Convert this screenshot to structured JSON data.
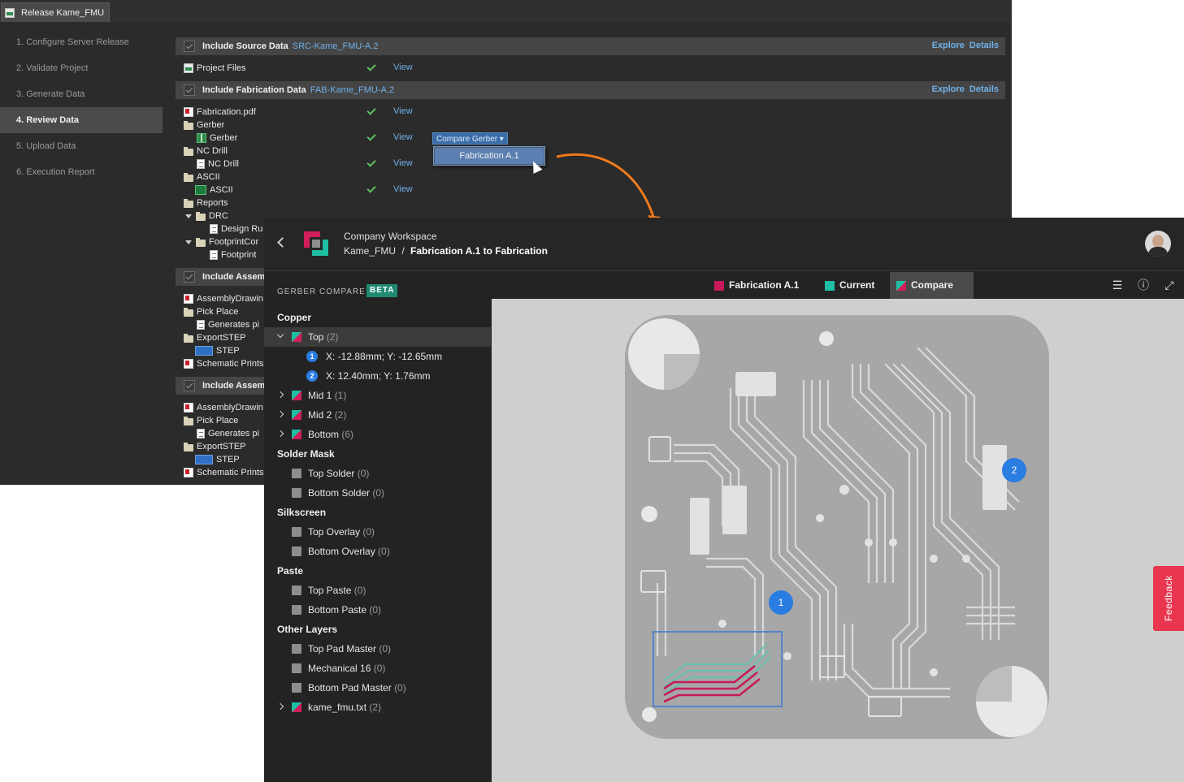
{
  "release_window": {
    "tab_label": "Release Kame_FMU",
    "steps": [
      {
        "label": "1. Configure Server Release"
      },
      {
        "label": "2. Validate Project"
      },
      {
        "label": "3. Generate Data"
      },
      {
        "label": "4. Review Data"
      },
      {
        "label": "5. Upload Data"
      },
      {
        "label": "6. Execution Report"
      }
    ],
    "active_step": "4. Review Data",
    "sections": [
      {
        "title": "Include Source Data",
        "id": "SRC-Kame_FMU-A.2",
        "explore": "Explore",
        "details": "Details"
      },
      {
        "title": "Include Fabrication Data",
        "id": "FAB-Kame_FMU-A.2",
        "explore": "Explore",
        "details": "Details"
      },
      {
        "title": "Include Assem"
      },
      {
        "title": "Include Assem"
      }
    ],
    "rows": [
      {
        "label": "Project Files",
        "view": "View"
      },
      {
        "label": "Fabrication.pdf",
        "view": "View"
      },
      {
        "label": "Gerber"
      },
      {
        "label": "Gerber",
        "view": "View"
      },
      {
        "label": "NC Drill"
      },
      {
        "label": "NC Drill",
        "view": "View"
      },
      {
        "label": "ASCII"
      },
      {
        "label": "ASCII",
        "view": "View"
      },
      {
        "label": "Reports"
      },
      {
        "label": "DRC"
      },
      {
        "label": "Design Ru"
      },
      {
        "label": "FootprintCor"
      },
      {
        "label": "Footprint"
      },
      {
        "label": "AssemblyDrawin"
      },
      {
        "label": "Pick Place"
      },
      {
        "label": "Generates pi"
      },
      {
        "label": "ExportSTEP"
      },
      {
        "label": "STEP"
      },
      {
        "label": "Schematic Prints"
      },
      {
        "label": "AssemblyDrawin"
      },
      {
        "label": "Pick Place"
      },
      {
        "label": "Generates pi"
      },
      {
        "label": "ExportSTEP"
      },
      {
        "label": "STEP"
      },
      {
        "label": "Schematic Prints"
      }
    ],
    "compare_button": "Compare Gerber ▾",
    "compare_menu_item": "Fabrication A.1"
  },
  "web": {
    "workspace": "Company Workspace",
    "project": "Kame_FMU",
    "separator": "/",
    "page_title": "Fabrication A.1 to Fabrication",
    "panel_title": "GERBER COMPARE",
    "beta": "BETA",
    "groups": {
      "copper": "Copper",
      "solder_mask": "Solder Mask",
      "silkscreen": "Silkscreen",
      "paste": "Paste",
      "other": "Other Layers"
    },
    "layers": {
      "top": {
        "name": "Top",
        "count": "(2)"
      },
      "mid1": {
        "name": "Mid 1",
        "count": "(1)"
      },
      "mid2": {
        "name": "Mid 2",
        "count": "(2)"
      },
      "bottom": {
        "name": "Bottom",
        "count": "(6)"
      },
      "top_solder": {
        "name": "Top Solder",
        "count": "(0)"
      },
      "bottom_solder": {
        "name": "Bottom Solder",
        "count": "(0)"
      },
      "top_overlay": {
        "name": "Top Overlay",
        "count": "(0)"
      },
      "bottom_overlay": {
        "name": "Bottom Overlay",
        "count": "(0)"
      },
      "top_paste": {
        "name": "Top Paste",
        "count": "(0)"
      },
      "bottom_paste": {
        "name": "Bottom Paste",
        "count": "(0)"
      },
      "top_pad_master": {
        "name": "Top Pad Master",
        "count": "(0)"
      },
      "mechanical16": {
        "name": "Mechanical 16",
        "count": "(0)"
      },
      "bottom_pad_master": {
        "name": "Bottom Pad Master",
        "count": "(0)"
      },
      "kame_txt": {
        "name": "kame_fmu.txt",
        "count": "(2)"
      }
    },
    "points": [
      {
        "num": "1",
        "coords": "X: -12.88mm; Y: -12.65mm"
      },
      {
        "num": "2",
        "coords": "X: 12.40mm; Y: 1.76mm"
      }
    ],
    "tabs": [
      {
        "label": "Fabrication A.1",
        "color": "#c8195a"
      },
      {
        "label": "Current",
        "color": "#1fbfa3"
      },
      {
        "label": "Compare",
        "active": true
      }
    ],
    "markers": [
      "1",
      "2"
    ],
    "feedback": "Feedback"
  },
  "colors": {
    "accent_blue": "#2a7de1",
    "link_blue": "#6fb0e8",
    "diff_old": "#c8195a",
    "diff_new": "#1fbfa3",
    "arrow": "#f07a1a"
  }
}
